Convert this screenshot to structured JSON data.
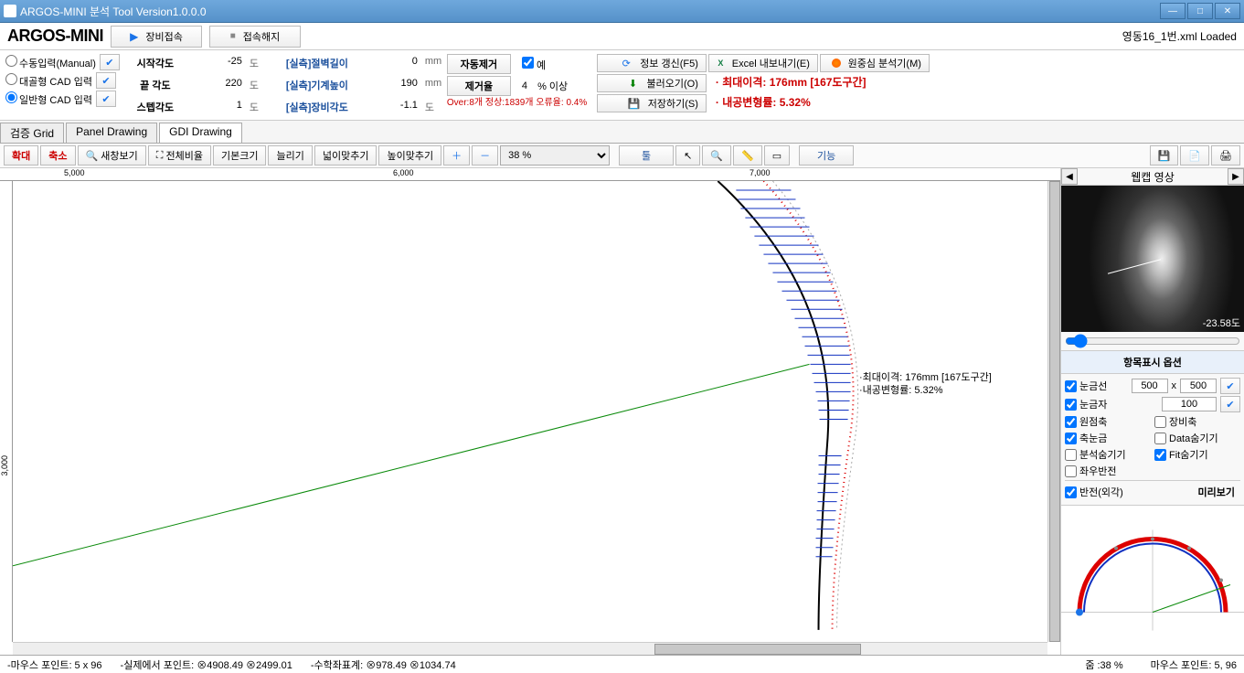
{
  "window": {
    "title": "ARGOS-MINI 분석 Tool Version1.0.0.0"
  },
  "header": {
    "logo": "ARGOS-MINI",
    "connect": "장비접속",
    "disconnect": "접속해지",
    "loaded_file": "영동16_1번.xml Loaded"
  },
  "input_modes": {
    "manual": "수동입력(Manual)",
    "cad_large": "대골형 CAD 입력",
    "cad_normal": "일반형 CAD 입력"
  },
  "params": {
    "start_angle_label": "시작각도",
    "start_angle_val": "-25",
    "start_angle_unit": "도",
    "end_angle_label": "끝 각도",
    "end_angle_val": "220",
    "end_angle_unit": "도",
    "step_angle_label": "스텝각도",
    "step_angle_val": "1",
    "step_angle_unit": "도",
    "wall_len_label": "[실측]절벽길이",
    "wall_len_val": "0",
    "wall_len_unit": "mm",
    "machine_h_label": "[실측]기계높이",
    "machine_h_val": "190",
    "machine_h_unit": "mm",
    "equip_angle_label": "[실측]장비각도",
    "equip_angle_val": "-1.1",
    "equip_angle_unit": "도",
    "auto_remove_label": "자동제거",
    "auto_remove_yes": "예",
    "remove_rate_label": "제거율",
    "remove_rate_val": "4",
    "remove_rate_unit": "% 이상",
    "error_text": "Over:8개 정상:1839개 오류율: 0.4%"
  },
  "actions": {
    "refresh": "정보 갱신(F5)",
    "excel": "Excel 내보내기(E)",
    "analyze": "원중심 분석기(M)",
    "load": "불러오기(O)",
    "save": "저장하기(S)"
  },
  "results": {
    "line1": "· 최대이격: 176mm [167도구간]",
    "line2": "· 내공변형률: 5.32%"
  },
  "tabs": {
    "t1": "검증 Grid",
    "t2": "Panel Drawing",
    "t3": "GDI Drawing"
  },
  "toolbar": {
    "zoom_in": "확대",
    "zoom_out": "축소",
    "new_window": "새창보기",
    "fit": "전체비율",
    "default_size": "기본크기",
    "stretch": "늘리기",
    "fit_width": "넓이맞추기",
    "fit_height": "높이맞추기",
    "zoom_val": "38 %",
    "tools": "툴",
    "function": "기능"
  },
  "canvas": {
    "ruler_5000": "5,000",
    "ruler_6000": "6,000",
    "ruler_7000": "7,000",
    "ruler_left": "3,000",
    "label1": "·최대이격: 176mm [167도구간]",
    "label2": "·내공변형률: 5.32%"
  },
  "right_panel": {
    "webcam_title": "웹캡 영상",
    "webcam_angle": "-23.58도",
    "options_title": "항목표시 옵션",
    "opt_grid": "눈금선",
    "opt_ruler": "눈금자",
    "opt_size_w": "500",
    "opt_size_x": "x",
    "opt_size_h": "500",
    "opt_ruler_val": "100",
    "opt_origin": "원점축",
    "opt_equip": "장비축",
    "opt_axis_scale": "축눈금",
    "opt_data_hide": "Data숨기기",
    "opt_analysis_hide": "분석숨기기",
    "opt_fit_hide": "Fit숨기기",
    "opt_flip": "좌우반전",
    "opt_reverse": "반전(외각)",
    "preview_title": "미리보기"
  },
  "status": {
    "mouse_point": "-마우스 포인트: 5 x 96",
    "real_point": "-실제에서 포인트:",
    "rx": "4908.49",
    "ry": "2499.01",
    "math_point": "-수학좌표계:",
    "mx": "978.49",
    "my": "1034.74",
    "zoom": "줌 :38 %",
    "mouse_point2": "마우스 포인트: 5, 96"
  },
  "chart_data": {
    "type": "arc-deviation-plot",
    "note": "reconstructed visual — arc segment with deviation hatching",
    "max_deviation_mm": 176,
    "max_deviation_angle_deg": 167,
    "deformation_rate_pct": 5.32
  }
}
